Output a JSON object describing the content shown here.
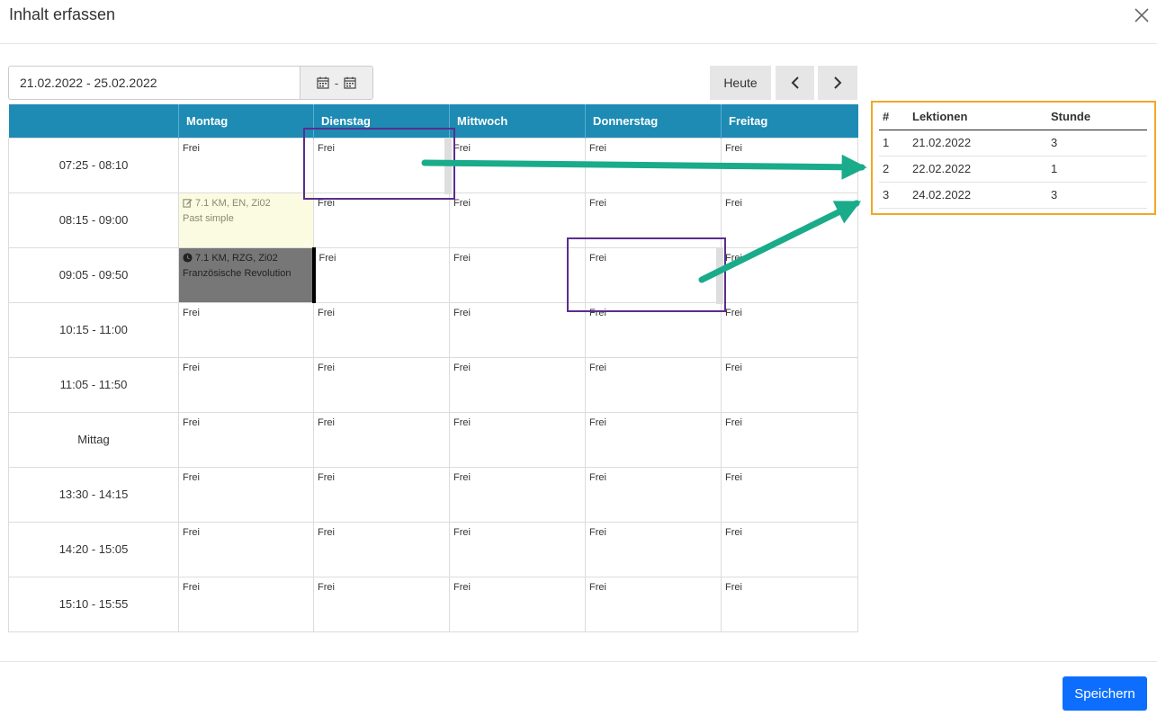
{
  "modal": {
    "title": "Inhalt erfassen",
    "save_label": "Speichern"
  },
  "toolbar": {
    "date_range": "21.02.2022 - 25.02.2022",
    "range_sep": "-",
    "today_label": "Heute",
    "icons": {
      "calendar": "calendar-icon",
      "prev": "chevron-left-icon",
      "next": "chevron-right-icon",
      "close": "close-icon"
    }
  },
  "schedule": {
    "days": [
      "Montag",
      "Dienstag",
      "Mittwoch",
      "Donnerstag",
      "Freitag"
    ],
    "free_label": "Frei",
    "times": [
      "07:25 - 08:10",
      "08:15 - 09:00",
      "09:05 - 09:50",
      "10:15 - 11:00",
      "11:05 - 11:50",
      "Mittag",
      "13:30 - 14:15",
      "14:20 - 15:05",
      "15:10 - 15:55"
    ],
    "lesson_yellow": {
      "line1": "7.1 KM, EN, Zi02",
      "line2": "Past simple",
      "icon": "edit-icon"
    },
    "lesson_dark": {
      "line1": "7.1 KM, RZG, Zi02",
      "line2": "Französische Revolution",
      "icon": "clock-icon"
    }
  },
  "summary": {
    "headers": [
      "#",
      "Lektionen",
      "Stunde"
    ],
    "rows": [
      [
        "1",
        "21.02.2022",
        "3"
      ],
      [
        "2",
        "22.02.2022",
        "1"
      ],
      [
        "3",
        "24.02.2022",
        "3"
      ]
    ]
  },
  "colors": {
    "header": "#1d8bb3",
    "purple": "#5b2d8e",
    "orange": "#f0a826",
    "arrow": "#1aab8a",
    "primary": "#0d6efd"
  }
}
